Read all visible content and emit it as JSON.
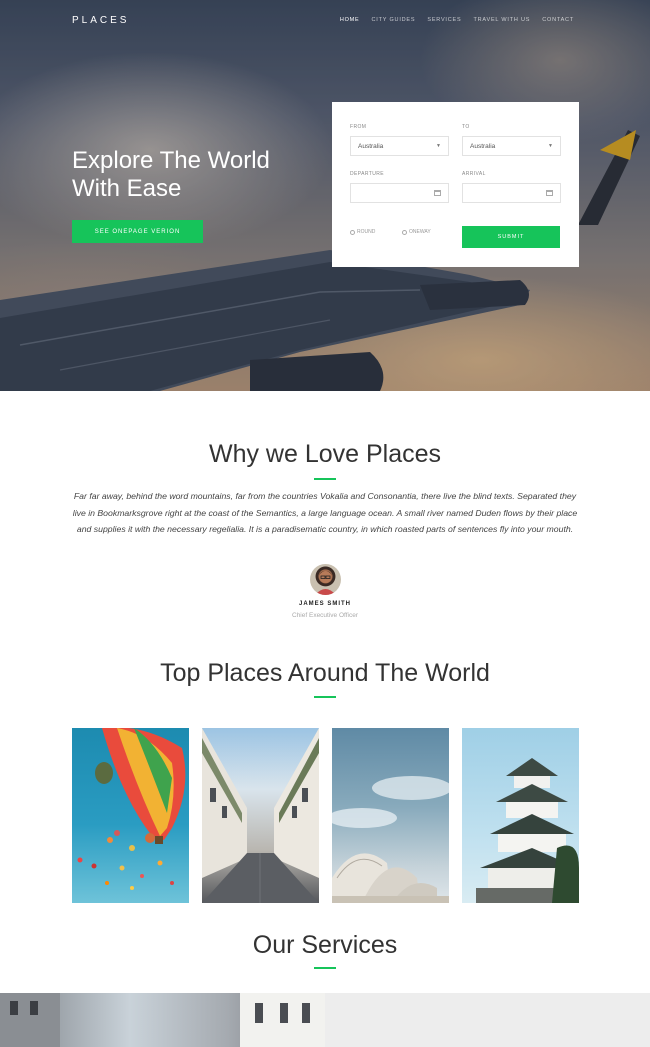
{
  "nav": {
    "logo": "PLACES",
    "items": [
      {
        "label": "HOME",
        "active": true
      },
      {
        "label": "CITY GUIDES",
        "active": false
      },
      {
        "label": "SERVICES",
        "active": false
      },
      {
        "label": "TRAVEL WITH US",
        "active": false
      },
      {
        "label": "CONTACT",
        "active": false
      }
    ]
  },
  "hero": {
    "title": "Explore The World With Ease",
    "button_label": "SEE ONEPAGE VERION"
  },
  "booking": {
    "from_label": "FROM",
    "from_value": "Australia",
    "to_label": "TO",
    "to_value": "Australia",
    "departure_label": "DEPARTURE",
    "arrival_label": "ARRIVAL",
    "radio_round": "ROUND",
    "radio_oneway": "ONEWAY",
    "submit_label": "SUBMIT"
  },
  "why": {
    "title": "Why we Love Places",
    "quote": "Far far away, behind the word mountains, far from the countries Vokalia and Consonantia, there live the blind texts. Separated they live in Bookmarksgrove right at the coast of the Semantics, a large language ocean. A small river named Duden flows by their place and supplies it with the necessary regelialia. It is a paradisematic country, in which roasted parts of sentences fly into your mouth.",
    "author_name": "JAMES SMITH",
    "author_role": "Chief Executive Officer"
  },
  "places": {
    "title": "Top Places Around The World"
  },
  "services": {
    "title": "Our Services"
  },
  "colors": {
    "accent": "#16c45a"
  }
}
